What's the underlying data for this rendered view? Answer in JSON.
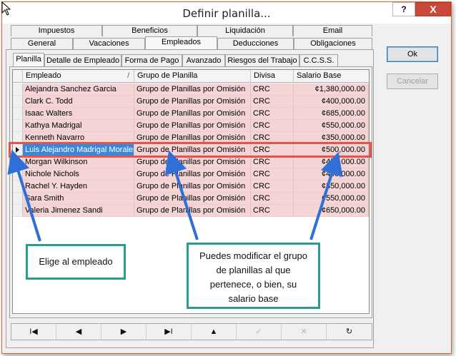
{
  "window": {
    "title": "Definir planilla...",
    "help_label": "?",
    "close_label": "X"
  },
  "tabs_row1": [
    "Impuestos",
    "Beneficios",
    "Liquidación",
    "Email"
  ],
  "tabs_row2": [
    "General",
    "Vacaciones",
    "Empleados",
    "Deducciones",
    "Obligaciones"
  ],
  "active_tab": "Empleados",
  "subtabs": [
    "Planilla",
    "Detalle de Empleado",
    "Forma de Pago",
    "Avanzado",
    "Riesgos del Trabajo",
    "C.C.S.S."
  ],
  "active_subtab": "Planilla",
  "grid": {
    "columns": [
      "Empleado",
      "Grupo de Planilla",
      "Divisa",
      "Salario Base"
    ],
    "sort_mark": "/",
    "rows": [
      {
        "empleado": "Alejandra Sanchez Garcia",
        "grupo": "Grupo de Planillas por Omisión",
        "divisa": "CRC",
        "salario": "¢1,380,000.00"
      },
      {
        "empleado": "Clark C. Todd",
        "grupo": "Grupo de Planillas por Omisión",
        "divisa": "CRC",
        "salario": "¢400,000.00"
      },
      {
        "empleado": "Isaac Walters",
        "grupo": "Grupo de Planillas por Omisión",
        "divisa": "CRC",
        "salario": "¢685,000.00"
      },
      {
        "empleado": "Kathya Madrigal",
        "grupo": "Grupo de Planillas por Omisión",
        "divisa": "CRC",
        "salario": "¢550,000.00"
      },
      {
        "empleado": "Kenneth Navarro",
        "grupo": "Grupo de Planillas por Omisión",
        "divisa": "CRC",
        "salario": "¢350,000.00"
      },
      {
        "empleado": "Luis Alejandro Madrigal Morales",
        "grupo": "Grupo de Planillas por Omisión",
        "divisa": "CRC",
        "salario": "¢500,000.00"
      },
      {
        "empleado": "Morgan Wilkinson",
        "grupo": "Grupo de Planillas por Omisión",
        "divisa": "CRC",
        "salario": "¢450,000.00"
      },
      {
        "empleado": "Nichole Nichols",
        "grupo": "Grupo de Planillas por Omisión",
        "divisa": "CRC",
        "salario": "¢400,000.00"
      },
      {
        "empleado": "Rachel Y. Hayden",
        "grupo": "Grupo de Planillas por Omisión",
        "divisa": "CRC",
        "salario": "¢350,000.00"
      },
      {
        "empleado": "Sara Smith",
        "grupo": "Grupo de Planillas por Omisión",
        "divisa": "CRC",
        "salario": "¢550,000.00"
      },
      {
        "empleado": "Valeria Jimenez Sandi",
        "grupo": "Grupo de Planillas por Omisión",
        "divisa": "CRC",
        "salario": "¢650,000.00"
      }
    ],
    "selected_row": "Luis Alejandro Madrigal Morales"
  },
  "navigator": {
    "first": "I◀",
    "prior": "◀",
    "next": "▶",
    "last": "▶I",
    "insert": "▲",
    "post": "✓",
    "cancel": "✕",
    "refresh": "↻"
  },
  "buttons": {
    "ok": "Ok",
    "cancel": "Cancelar"
  },
  "callouts": {
    "employee": "Elige al empleado",
    "group_line1": "Puedes modificar el grupo",
    "group_line2": "de planillas al que",
    "group_line3": "pertenece, o bien, su",
    "group_line4": "salario base"
  },
  "colors": {
    "row_bg": "#f4d4d4",
    "selection": "#3a88d6",
    "highlight_box": "#e4544c",
    "callout_border": "#2a9d8f",
    "arrow": "#2f6fd8",
    "close_button": "#c9483b"
  }
}
